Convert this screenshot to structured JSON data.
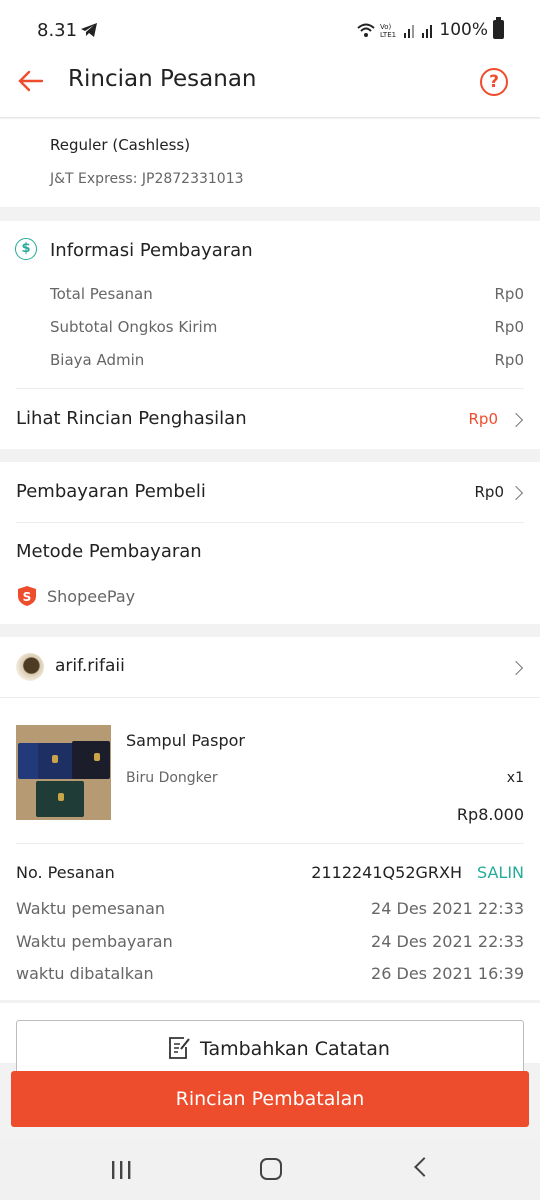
{
  "status_bar": {
    "time": "8.31",
    "battery": "100%"
  },
  "header": {
    "title": "Rincian Pesanan"
  },
  "shipping": {
    "service": "Reguler (Cashless)",
    "tracking": "J&T Express: JP2872331013"
  },
  "payment_info": {
    "title": "Informasi Pembayaran",
    "rows": [
      {
        "label": "Total Pesanan",
        "value": "Rp0"
      },
      {
        "label": "Subtotal Ongkos Kirim",
        "value": "Rp0"
      },
      {
        "label": "Biaya Admin",
        "value": "Rp0"
      }
    ],
    "income_label": "Lihat Rincian Penghasilan",
    "income_value": "Rp0"
  },
  "buyer_payment": {
    "label": "Pembayaran Pembeli",
    "value": "Rp0",
    "method_title": "Metode Pembayaran",
    "method": "ShopeePay"
  },
  "order": {
    "username": "arif.rifaii",
    "product_name": "Sampul Paspor",
    "variant": "Biru Dongker",
    "quantity": "x1",
    "price": "Rp8.000",
    "order_no_label": "No. Pesanan",
    "order_no": "2112241Q52GRXH",
    "copy_label": "SALIN",
    "times": [
      {
        "label": "Waktu pemesanan",
        "value": "24 Des 2021 22:33"
      },
      {
        "label": "Waktu pembayaran",
        "value": "24 Des 2021 22:33"
      },
      {
        "label": "waktu dibatalkan",
        "value": "26 Des 2021 16:39"
      }
    ]
  },
  "actions": {
    "add_note": "Tambahkan Catatan",
    "cancel_details": "Rincian Pembatalan"
  },
  "colors": {
    "accent": "#ee4d2d",
    "teal": "#26aa99"
  }
}
